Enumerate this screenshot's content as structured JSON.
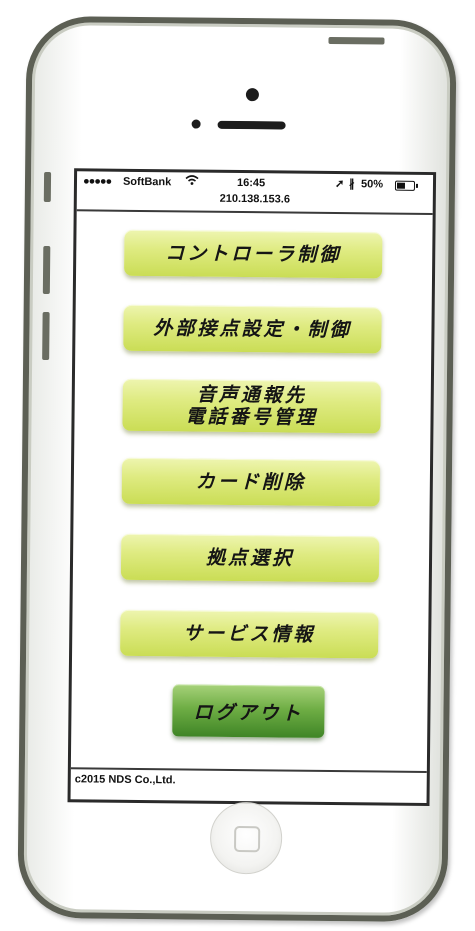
{
  "status_bar": {
    "signal": "●●●●●",
    "carrier": "SoftBank",
    "time": "16:45",
    "battery_percent": "50%",
    "battery_level": 0.5,
    "icons": [
      "wifi-icon",
      "location-arrow-icon",
      "bluetooth-icon",
      "battery-icon"
    ]
  },
  "address_bar": {
    "url": "210.138.153.6"
  },
  "menu": {
    "controller_control": "コントローラ制御",
    "external_contact": "外部接点設定・制御",
    "voice_notification": "音声通報先\n電話番号管理",
    "card_delete": "カード削除",
    "site_select": "拠点選択",
    "service_info": "サービス情報",
    "logout": "ログアウト"
  },
  "footer": {
    "copyright": "c2015 NDS Co.,Ltd."
  },
  "colors": {
    "menu_button": "#dfeb82",
    "logout_button": "#6fae45",
    "phone_frame": "#5c5f54"
  }
}
